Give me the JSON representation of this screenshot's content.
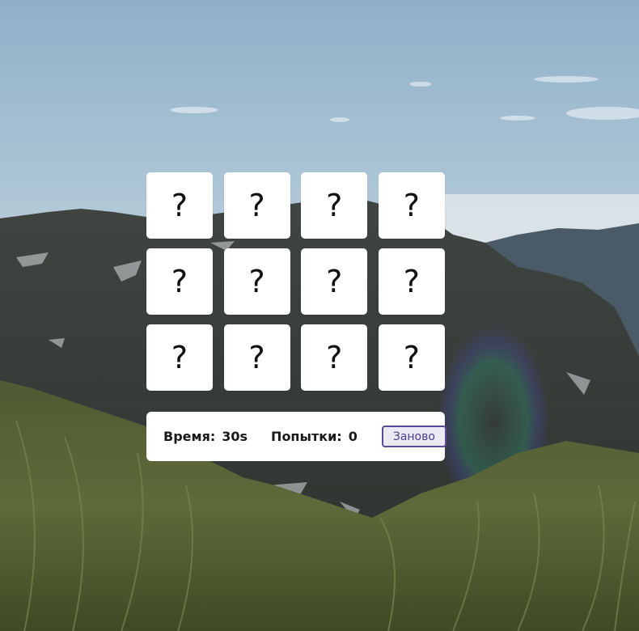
{
  "game": {
    "cards": [
      {
        "face": "?"
      },
      {
        "face": "?"
      },
      {
        "face": "?"
      },
      {
        "face": "?"
      },
      {
        "face": "?"
      },
      {
        "face": "?"
      },
      {
        "face": "?"
      },
      {
        "face": "?"
      },
      {
        "face": "?"
      },
      {
        "face": "?"
      },
      {
        "face": "?"
      },
      {
        "face": "?"
      }
    ]
  },
  "status": {
    "time_label": "Время:",
    "time_value": "30s",
    "attempts_label": "Попытки:",
    "attempts_value": "0",
    "reset_label": "Заново"
  },
  "colors": {
    "card_bg": "#ffffff",
    "button_border": "#5b4a9a",
    "button_bg": "#ece9f5",
    "button_text": "#4a3c8c"
  }
}
